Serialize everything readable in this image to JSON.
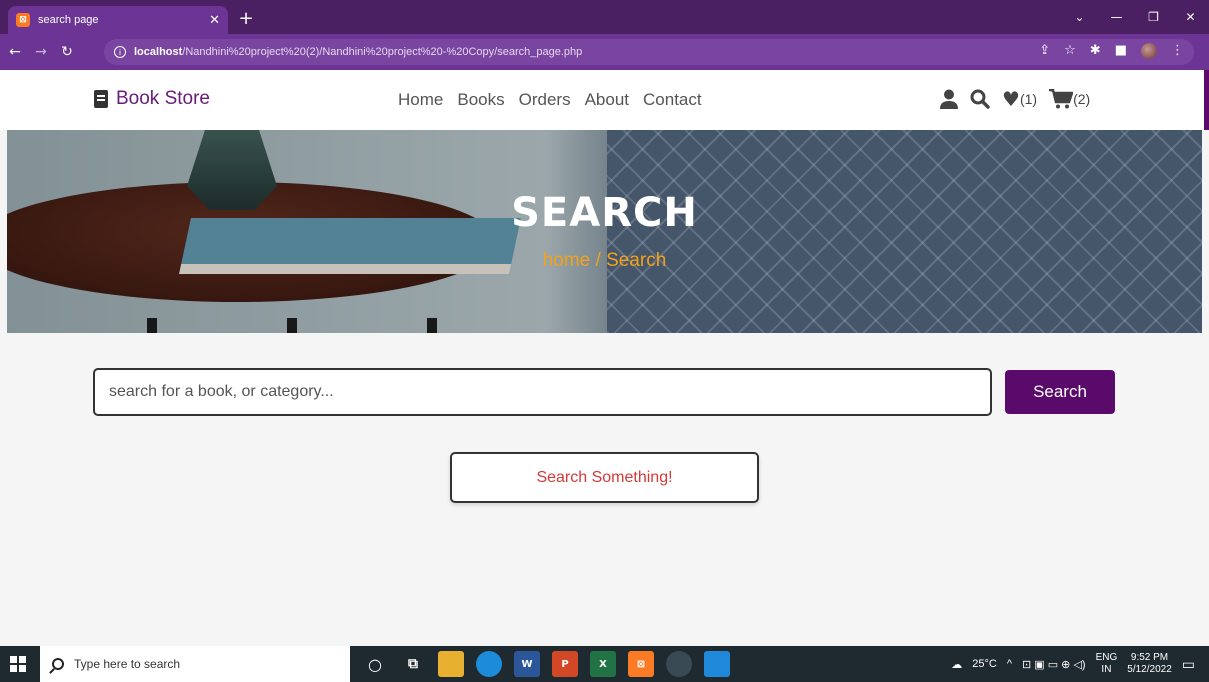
{
  "browser": {
    "tab_title": "search page",
    "tab_favicon": "xampp-icon",
    "url_host": "localhost",
    "url_path": "/Nandhini%20project%20(2)/Nandhini%20project%20-%20Copy/search_page.php",
    "window_controls": [
      "chevron-down",
      "minimize",
      "restore",
      "close"
    ]
  },
  "header": {
    "logo_text": "Book Store",
    "nav": [
      "Home",
      "Books",
      "Orders",
      "About",
      "Contact"
    ],
    "wishlist_count": "(1)",
    "cart_count": "(2)"
  },
  "hero": {
    "title": "SEARCH",
    "breadcrumb": "home / Search"
  },
  "search": {
    "placeholder": "search for a book, or category...",
    "value": "",
    "button_label": "Search",
    "empty_message": "Search Something!"
  },
  "taskbar": {
    "search_placeholder": "Type here to search",
    "weather": "25°C",
    "language": "ENG",
    "region": "IN",
    "time": "9:52 PM",
    "date": "5/12/2022"
  },
  "colors": {
    "brand_purple": "#5a0a6b",
    "breadcrumb_orange": "#f3a21a",
    "empty_red": "#d33a3a"
  }
}
